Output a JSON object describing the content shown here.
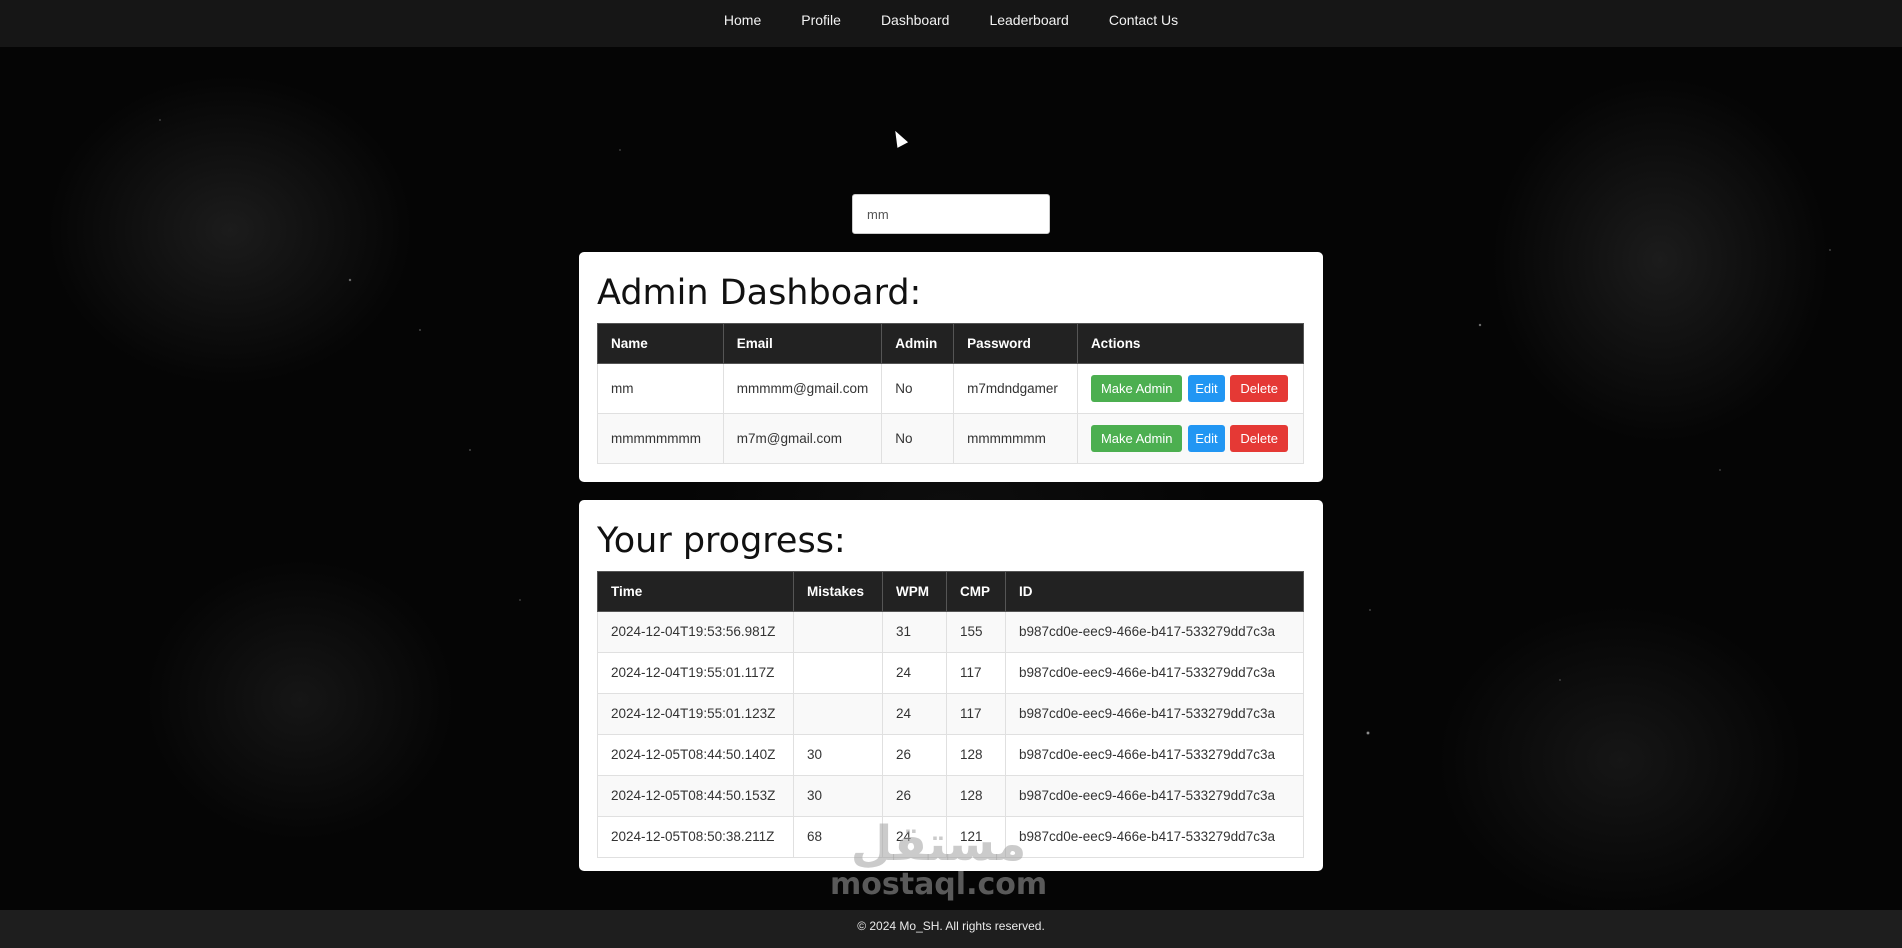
{
  "nav": {
    "links": [
      "Home",
      "Profile",
      "Dashboard",
      "Leaderboard",
      "Contact Us"
    ]
  },
  "search": {
    "value": "mm"
  },
  "admin": {
    "title": "Admin Dashboard:",
    "columns": [
      "Name",
      "Email",
      "Admin",
      "Password",
      "Actions"
    ],
    "rows": [
      {
        "name": "mm",
        "email": "mmmmm@gmail.com",
        "admin": "No",
        "password": "m7mdndgamer"
      },
      {
        "name": "mmmmmmmm",
        "email": "m7m@gmail.com",
        "admin": "No",
        "password": "mmmmmmm"
      }
    ],
    "actions": {
      "make_admin": "Make Admin",
      "edit": "Edit",
      "delete": "Delete"
    }
  },
  "progress": {
    "title": "Your progress:",
    "columns": [
      "Time",
      "Mistakes",
      "WPM",
      "CMP",
      "ID"
    ],
    "rows": [
      {
        "time": "2024-12-04T19:53:56.981Z",
        "mistakes": "",
        "wpm": "31",
        "cmp": "155",
        "id": "b987cd0e-eec9-466e-b417-533279dd7c3a"
      },
      {
        "time": "2024-12-04T19:55:01.117Z",
        "mistakes": "",
        "wpm": "24",
        "cmp": "117",
        "id": "b987cd0e-eec9-466e-b417-533279dd7c3a"
      },
      {
        "time": "2024-12-04T19:55:01.123Z",
        "mistakes": "",
        "wpm": "24",
        "cmp": "117",
        "id": "b987cd0e-eec9-466e-b417-533279dd7c3a"
      },
      {
        "time": "2024-12-05T08:44:50.140Z",
        "mistakes": "30",
        "wpm": "26",
        "cmp": "128",
        "id": "b987cd0e-eec9-466e-b417-533279dd7c3a"
      },
      {
        "time": "2024-12-05T08:44:50.153Z",
        "mistakes": "30",
        "wpm": "26",
        "cmp": "128",
        "id": "b987cd0e-eec9-466e-b417-533279dd7c3a"
      },
      {
        "time": "2024-12-05T08:50:38.211Z",
        "mistakes": "68",
        "wpm": "24",
        "cmp": "121",
        "id": "b987cd0e-eec9-466e-b417-533279dd7c3a"
      }
    ]
  },
  "footer": {
    "text": "© 2024 Mo_SH. All rights reserved."
  },
  "watermark": {
    "arabic": "مستقل",
    "latin": "mostaql.com"
  }
}
